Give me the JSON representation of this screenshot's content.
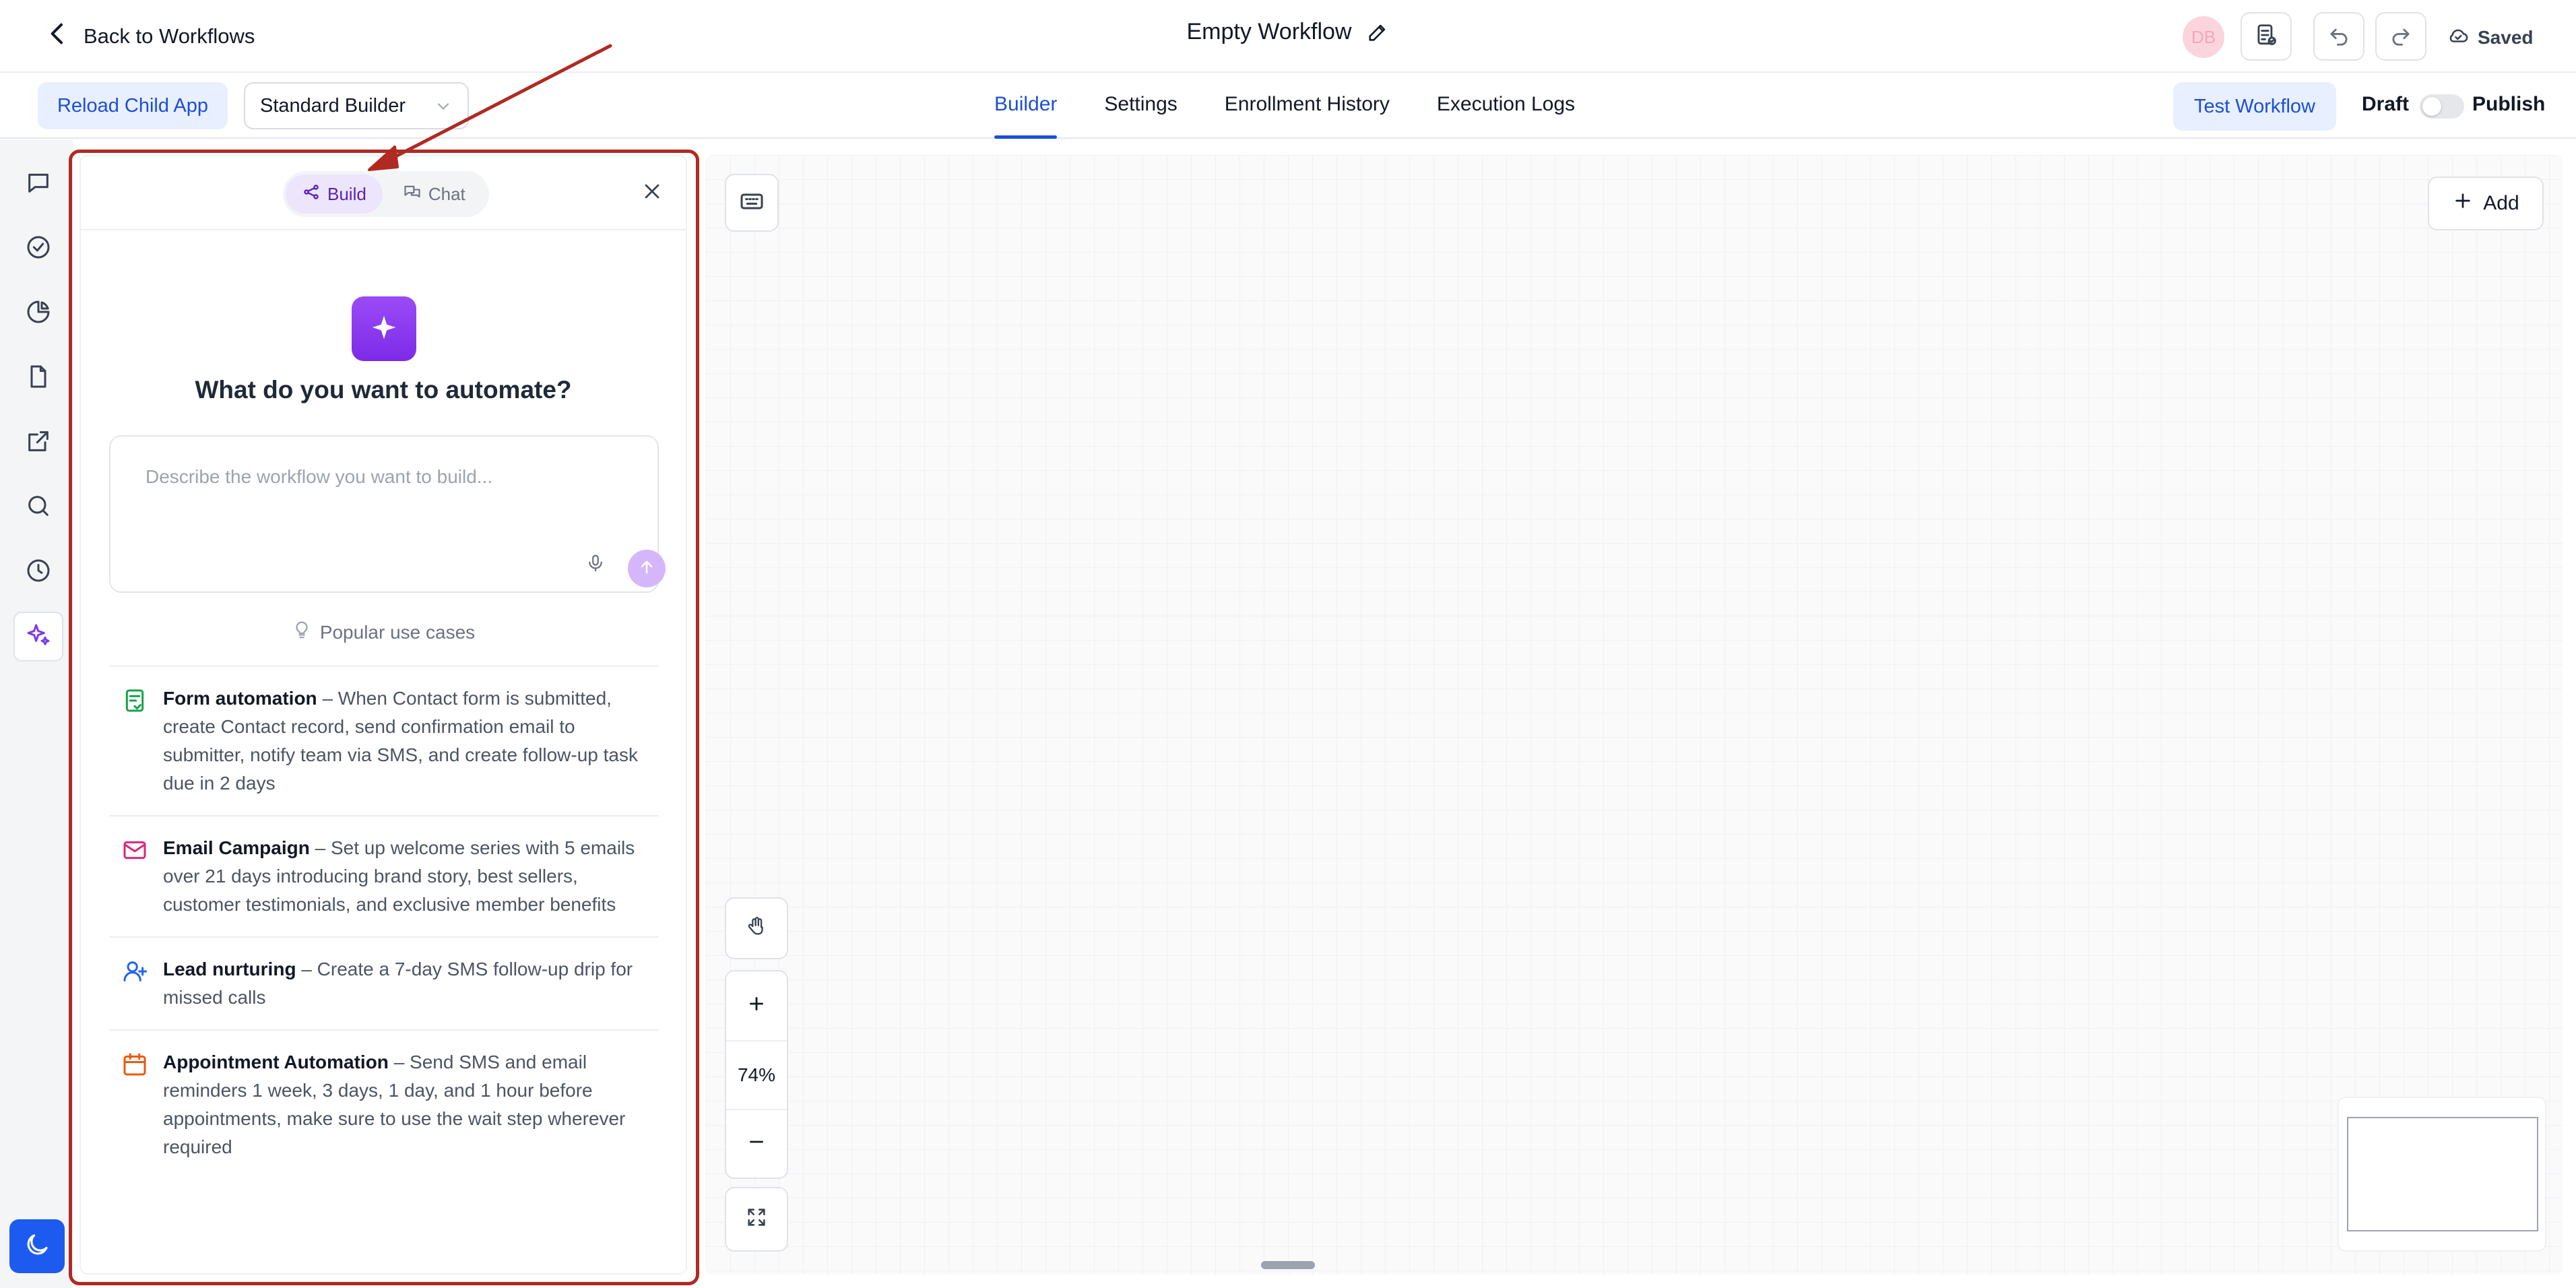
{
  "header": {
    "back_label": "Back to Workflows",
    "title": "Empty Workflow",
    "avatar_initials": "DB",
    "saved_label": "Saved"
  },
  "subbar": {
    "reload_label": "Reload Child App",
    "builder_select": "Standard Builder",
    "tabs": [
      {
        "label": "Builder",
        "active": true
      },
      {
        "label": "Settings"
      },
      {
        "label": "Enrollment History"
      },
      {
        "label": "Execution Logs"
      }
    ],
    "test_label": "Test Workflow",
    "draft_label": "Draft",
    "publish_label": "Publish"
  },
  "panel": {
    "mode_build": "Build",
    "mode_chat": "Chat",
    "headline": "What do you want to automate?",
    "prompt_placeholder": "Describe the workflow you want to build...",
    "popular_label": "Popular use cases",
    "use_cases": [
      {
        "title": "Form automation",
        "desc": "– When Contact form is submitted, create Contact record, send confirmation email to submitter, notify team via SMS, and create follow-up task due in 2 days",
        "icon": "form-icon",
        "color": "#16a34a"
      },
      {
        "title": "Email Campaign",
        "desc": "– Set up welcome series with 5 emails over 21 days introducing brand story, best sellers, customer testimonials, and exclusive member benefits",
        "icon": "mail-icon",
        "color": "#db2777"
      },
      {
        "title": "Lead nurturing",
        "desc": "– Create a 7-day SMS follow-up drip for missed calls",
        "icon": "user-plus-icon",
        "color": "#2563eb"
      },
      {
        "title": "Appointment Automation",
        "desc": "– Send SMS and email reminders 1 week, 3 days, 1 day, and 1 hour before appointments, make sure to use the wait step wherever required",
        "icon": "calendar-icon",
        "color": "#ea580c"
      }
    ]
  },
  "canvas": {
    "add_label": "Add",
    "zoom_level": "74%"
  },
  "colors": {
    "accent": "#1d4ed8",
    "ai_purple": "#7c3aed",
    "highlight_red": "#b02a22"
  }
}
